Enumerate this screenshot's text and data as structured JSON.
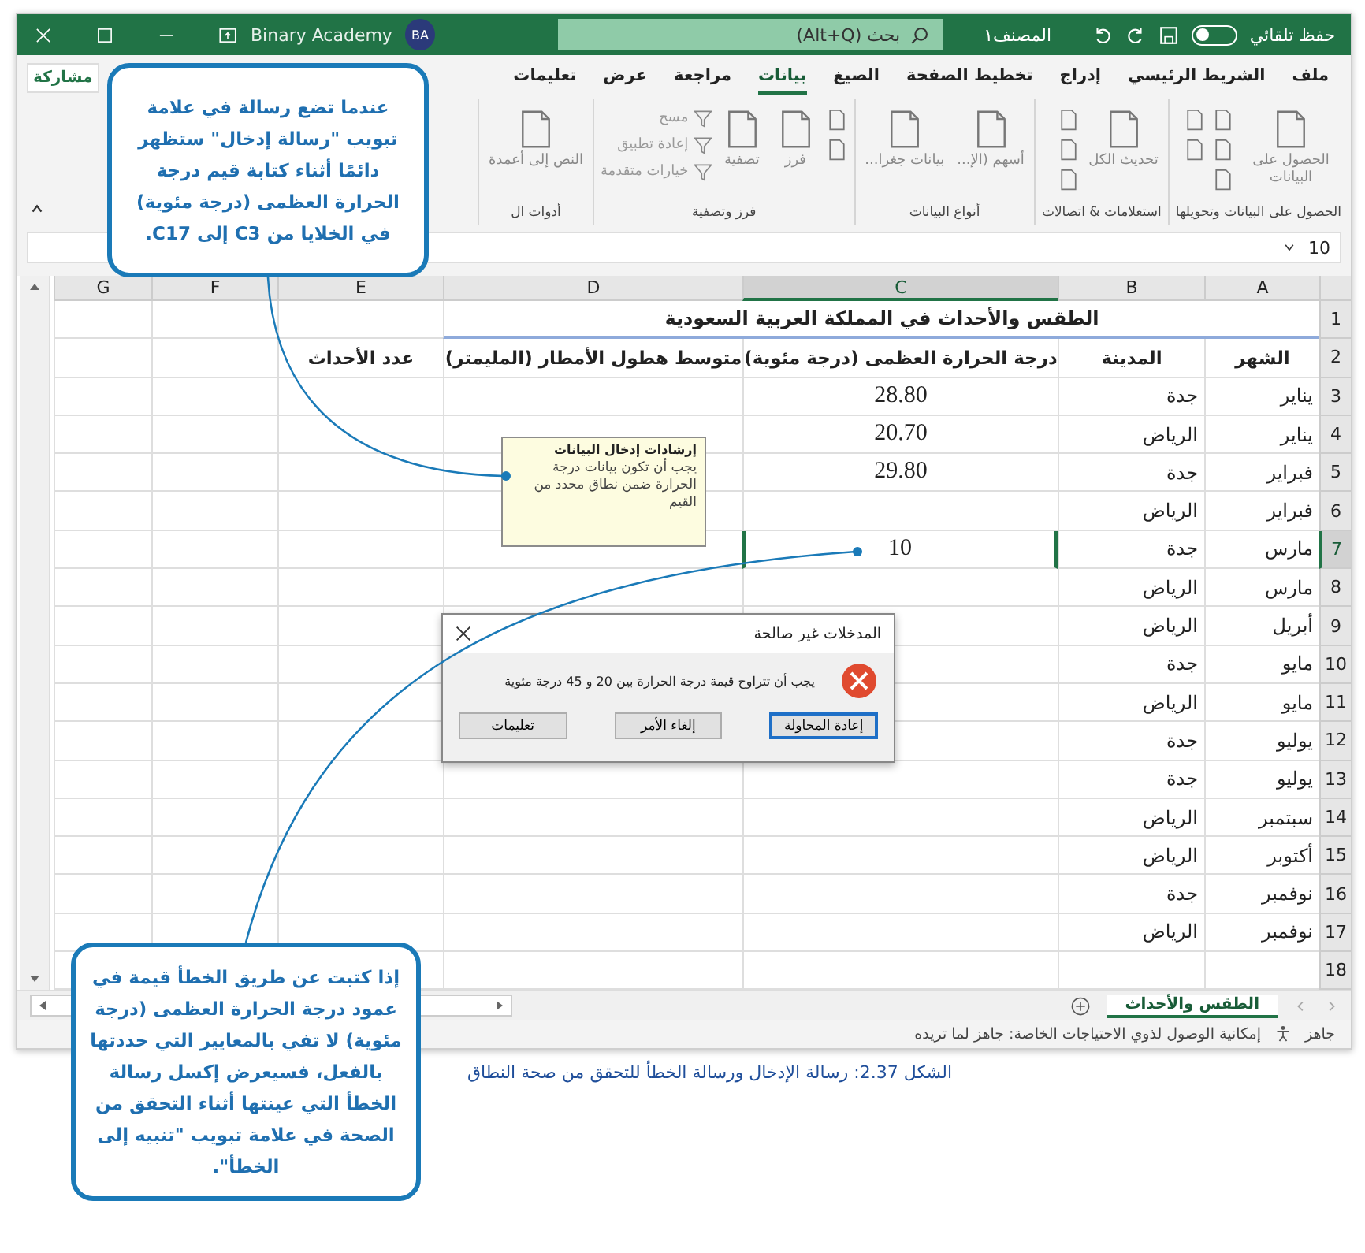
{
  "title_bar": {
    "autosave": {
      "label": "حفظ تلقائي",
      "on": false
    },
    "file_name": "المصنف١",
    "search": {
      "placeholder": "بحث (Alt+Q)"
    },
    "user": {
      "initials": "BA",
      "name": "Binary Academy"
    }
  },
  "ribbon": {
    "tabs": [
      {
        "label": "ملف",
        "selected": false
      },
      {
        "label": "الشريط الرئيسي",
        "selected": false
      },
      {
        "label": "إدراج",
        "selected": false
      },
      {
        "label": "تخطيط الصفحة",
        "selected": false
      },
      {
        "label": "الصيغ",
        "selected": false
      },
      {
        "label": "بيانات",
        "selected": true
      },
      {
        "label": "مراجعة",
        "selected": false
      },
      {
        "label": "عرض",
        "selected": false
      },
      {
        "label": "تعليمات",
        "selected": false
      }
    ],
    "share_button": "مشاركة",
    "groups": [
      {
        "label": "الحصول على البيانات وتحويلها",
        "buttons": [
          {
            "kind": "large",
            "label": "الحصول على البيانات"
          },
          {
            "kind": "icon"
          },
          {
            "kind": "icon"
          },
          {
            "kind": "icon"
          },
          {
            "kind": "icon"
          },
          {
            "kind": "icon"
          }
        ]
      },
      {
        "label": "استعلامات & اتصالات",
        "buttons": [
          {
            "kind": "large",
            "label": "تحديث الكل"
          },
          {
            "kind": "icon"
          },
          {
            "kind": "icon"
          },
          {
            "kind": "icon"
          }
        ]
      },
      {
        "label": "أنواع البيانات",
        "buttons": [
          {
            "kind": "large",
            "label": "أسهم (الإ..."
          },
          {
            "kind": "large",
            "label": "بيانات جغرا..."
          }
        ]
      },
      {
        "label": "فرز وتصفية",
        "buttons": [
          {
            "kind": "icon"
          },
          {
            "kind": "icon"
          },
          {
            "kind": "large",
            "label": "فرز"
          },
          {
            "kind": "large",
            "label": "تصفية"
          },
          {
            "kind": "small",
            "label": "مسح"
          },
          {
            "kind": "small",
            "label": "إعادة تطبيق"
          },
          {
            "kind": "small",
            "label": "خيارات متقدمة"
          }
        ]
      },
      {
        "label": "أدوات ال",
        "buttons": [
          {
            "kind": "large",
            "label": "النص إلى أعمدة"
          }
        ]
      }
    ]
  },
  "formula_bar": {
    "value": "10"
  },
  "sheet": {
    "columns": [
      {
        "label": "A",
        "selected": false
      },
      {
        "label": "B",
        "selected": false
      },
      {
        "label": "C",
        "selected": true
      },
      {
        "label": "D",
        "selected": false
      },
      {
        "label": "E",
        "selected": false
      },
      {
        "label": "F",
        "selected": false
      },
      {
        "label": "G",
        "selected": false
      }
    ],
    "title_row": {
      "number": "1",
      "text": "الطقس والأحداث في المملكة العربية السعودية"
    },
    "header_row": {
      "number": "2",
      "cells": [
        "الشهر",
        "المدينة",
        "درجة الحرارة العظمى (درجة مئوية)",
        "متوسط هطول الأمطار (المليمتر)",
        "عدد الأحداث"
      ]
    },
    "rows": [
      {
        "number": "3",
        "month": "يناير",
        "city": "جدة",
        "max_temp": "28.80",
        "selected": false
      },
      {
        "number": "4",
        "month": "يناير",
        "city": "الرياض",
        "max_temp": "20.70",
        "selected": false
      },
      {
        "number": "5",
        "month": "فبراير",
        "city": "جدة",
        "max_temp": "29.80",
        "selected": false
      },
      {
        "number": "6",
        "month": "فبراير",
        "city": "الرياض",
        "selected": false
      },
      {
        "number": "7",
        "month": "مارس",
        "city": "جدة",
        "max_temp": "10",
        "selected": true
      },
      {
        "number": "8",
        "month": "مارس",
        "city": "الرياض",
        "selected": false
      },
      {
        "number": "9",
        "month": "أبريل",
        "city": "الرياض",
        "selected": false
      },
      {
        "number": "10",
        "month": "مايو",
        "city": "جدة",
        "selected": false
      },
      {
        "number": "11",
        "month": "مايو",
        "city": "الرياض",
        "selected": false
      },
      {
        "number": "12",
        "month": "يوليو",
        "city": "جدة",
        "selected": false
      },
      {
        "number": "13",
        "month": "يوليو",
        "city": "جدة",
        "selected": false
      },
      {
        "number": "14",
        "month": "سبتمبر",
        "city": "الرياض",
        "selected": false
      },
      {
        "number": "15",
        "month": "أكتوبر",
        "city": "الرياض",
        "selected": false
      },
      {
        "number": "16",
        "month": "نوفمبر",
        "city": "جدة",
        "selected": false
      },
      {
        "number": "17",
        "month": "نوفمبر",
        "city": "الرياض",
        "selected": false
      },
      {
        "number": "18",
        "selected": false
      }
    ],
    "sheet_tabs": [
      {
        "label": "الطقس والأحداث",
        "selected": true
      }
    ]
  },
  "status_bar": {
    "state": "جاهز",
    "accessibility": "إمكانية الوصول لذوي الاحتياجات الخاصة: جاهز لما تريده"
  },
  "input_message": {
    "title": "إرشادات إدخال البيانات",
    "text": "يجب أن تكون بيانات درجة الحرارة ضمن نطاق محدد من القيم"
  },
  "error_dialog": {
    "title": "المدخلات غير صالحة",
    "message": "يجب أن تتراوح قيمة درجة الحرارة بين 20 و 45 درجة مئوية",
    "buttons": [
      {
        "label": "إعادة المحاولة",
        "default": true
      },
      {
        "label": "إلغاء الأمر",
        "default": false
      },
      {
        "label": "تعليمات",
        "default": false
      }
    ]
  },
  "callouts": [
    {
      "text": "عندما تضع رسالة في علامة تبويب \"رسالة إدخال\" ستظهر دائمًا أثناء كتابة قيم درجة الحرارة العظمى (درجة مئوية) في الخلايا من C3 إلى C17."
    },
    {
      "text": "إذا كتبت عن طريق الخطأ قيمة في عمود درجة الحرارة العظمى (درجة مئوية) لا تفي بالمعايير التي حددتها بالفعل، فسيعرض إكسل رسالة الخطأ التي عينتها أثناء التحقق من الصحة في علامة تبويب \"تنبيه إلى الخطأ\"."
    }
  ],
  "caption": "الشكل 2.37: رسالة الإدخال ورسالة الخطأ للتحقق من صحة النطاق"
}
